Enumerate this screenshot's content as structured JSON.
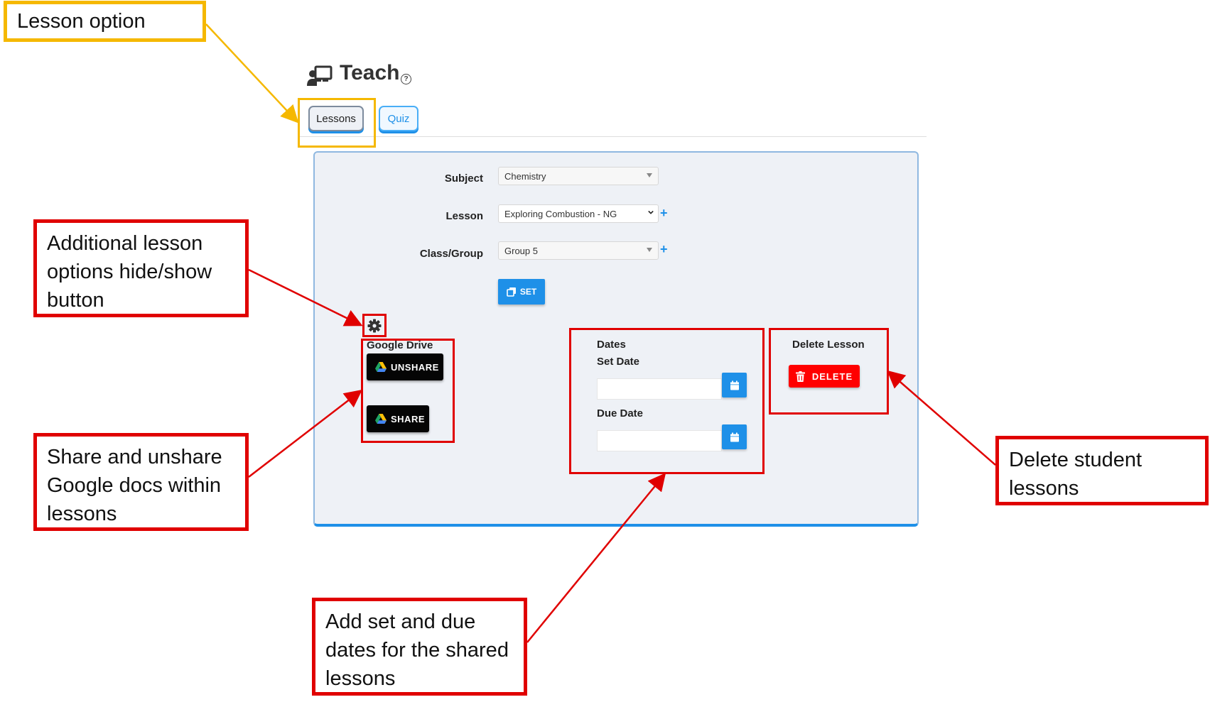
{
  "header": {
    "title": "Teach",
    "help": "?"
  },
  "tabs": [
    {
      "label": "Lessons",
      "active": true
    },
    {
      "label": "Quiz",
      "active": false
    }
  ],
  "form": {
    "subject": {
      "label": "Subject",
      "value": "Chemistry"
    },
    "lesson": {
      "label": "Lesson",
      "value": "Exploring Combustion - NG",
      "add": "+"
    },
    "class_group": {
      "label": "Class/Group",
      "value": "Group 5",
      "add": "+"
    },
    "set_button": "SET"
  },
  "google_drive": {
    "title": "Google Drive",
    "unshare_button": "UNSHARE",
    "share_button": "SHARE"
  },
  "dates": {
    "title": "Dates",
    "set_date_label": "Set Date",
    "due_date_label": "Due Date",
    "set_date_value": "",
    "due_date_value": ""
  },
  "delete_section": {
    "title": "Delete Lesson",
    "button": "DELETE"
  },
  "annotations": {
    "lesson_option": "Lesson option",
    "additional_options_l1": "Additional lesson",
    "additional_options_l2": "options hide/show",
    "additional_options_l3": "button",
    "share_unshare_l1": "Share and unshare",
    "share_unshare_l2": "Google docs within",
    "share_unshare_l3": "lessons",
    "dates_l1": "Add set and due",
    "dates_l2": "dates for the shared",
    "dates_l3": "lessons",
    "delete_l1": "Delete student",
    "delete_l2": "lessons"
  },
  "colors": {
    "accent": "#1e90e8",
    "danger": "#ff0000",
    "annotation_red": "#e00000",
    "annotation_yellow": "#f5b800",
    "panel_bg": "#eef1f6"
  }
}
